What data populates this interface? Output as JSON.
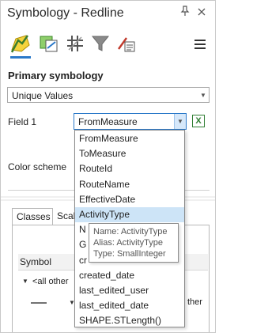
{
  "window": {
    "title": "Symbology - Redline",
    "pin_icon": "pin-icon",
    "close_icon": "close-icon"
  },
  "toolbar": {
    "tools": [
      {
        "name": "primary-symbology-icon",
        "active": true
      },
      {
        "name": "vary-by-attribute-icon",
        "active": false
      },
      {
        "name": "symbol-layers-icon",
        "active": false
      },
      {
        "name": "label-filter-icon",
        "active": false
      },
      {
        "name": "advanced-symbology-icon",
        "active": false
      }
    ],
    "menu_icon": "hamburger-menu-icon"
  },
  "primary_symbology": {
    "heading": "Primary symbology",
    "renderer": "Unique Values"
  },
  "field1": {
    "label": "Field 1",
    "value": "FromMeasure"
  },
  "color_scheme": {
    "label": "Color scheme"
  },
  "tabs": {
    "classes": "Classes",
    "scales_partial": "Scal"
  },
  "grid": {
    "symbol_header": "Symbol",
    "all_other_row": "<all other",
    "other_partial": "ther"
  },
  "dropdown": {
    "items": [
      "FromMeasure",
      "ToMeasure",
      "RouteId",
      "RouteName",
      "EffectiveDate",
      "ActivityType",
      "N",
      "G",
      "cr",
      "created_date",
      "last_edited_user",
      "last_edited_date",
      "SHAPE.STLength()"
    ],
    "selected_index": 5
  },
  "tooltip": {
    "name": "Name: ActivityType",
    "alias": "Alias: ActivityType",
    "type": "Type: SmallInteger"
  },
  "colors": {
    "accent": "#2b79c9",
    "selection": "#cde4f7",
    "excel_green": "#2e7d32"
  }
}
